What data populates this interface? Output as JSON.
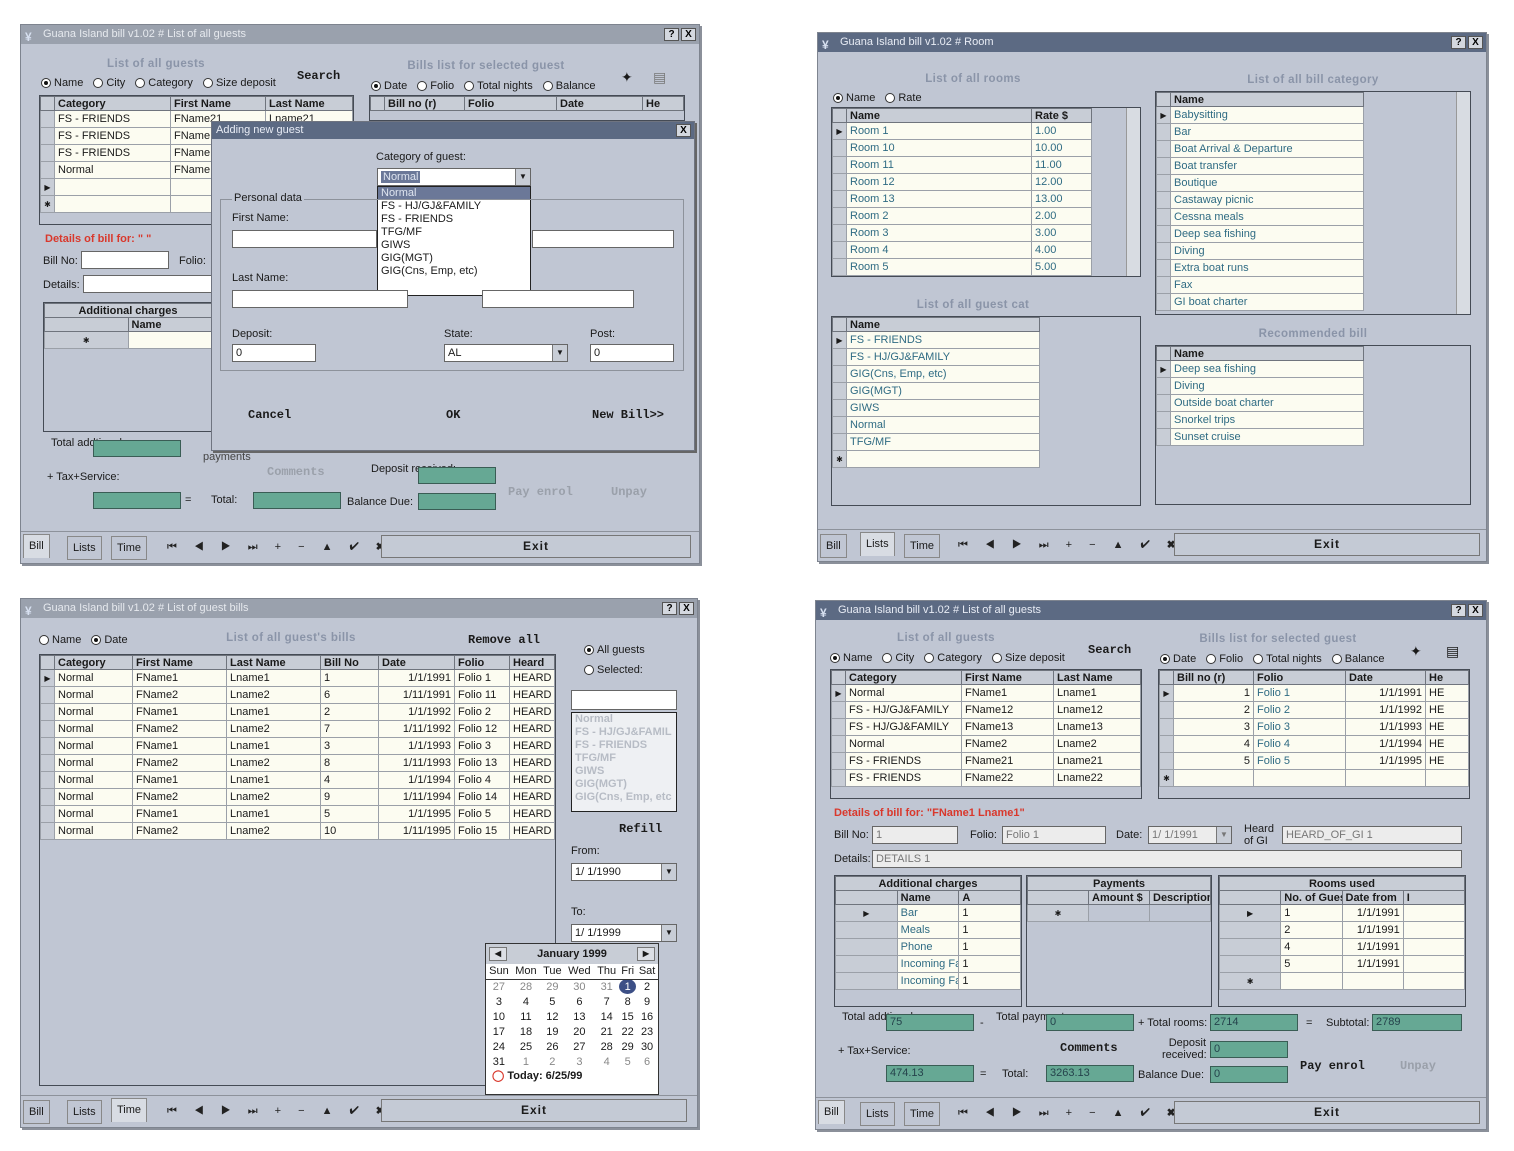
{
  "app_title_bill": "Guana Island bill v1.02 # List of all guests",
  "app_title_room": "Guana Island bill v1.02 # Room",
  "app_title_guest_bills": "Guana Island bill v1.02 # List of guest bills",
  "window_buttons": {
    "help": "?",
    "close": "X"
  },
  "tabs": {
    "bill": "Bill",
    "lists": "Lists",
    "time": "Time"
  },
  "exit_label": "Exit",
  "nav_glyphs": "⏮ ◀ ▶ ⏭ + − ▲ ✔ ✖ ↻",
  "guests_section": {
    "title": "List of all guests",
    "search_label": "Search",
    "radio_name": "Name",
    "radio_city": "City",
    "radio_category": "Category",
    "radio_size_deposit": "Size deposit",
    "columns": [
      "Category",
      "First Name",
      "Last Name"
    ]
  },
  "bills_section": {
    "title": "Bills list for selected guest",
    "radio_date": "Date",
    "radio_folio": "Folio",
    "radio_total_nights": "Total nights",
    "radio_balance": "Balance",
    "columns": [
      "Bill no (r)",
      "Folio",
      "Date",
      "He"
    ]
  },
  "win1": {
    "guest_rows": [
      {
        "cat": "FS - FRIENDS",
        "first": "FName21",
        "last": "Lname21"
      },
      {
        "cat": "FS - FRIENDS",
        "first": "FName",
        "last": ""
      },
      {
        "cat": "FS - FRIENDS",
        "first": "FName",
        "last": ""
      },
      {
        "cat": "Normal",
        "first": "FName",
        "last": ""
      }
    ],
    "details_title": "Details of bill for: \" \"",
    "bill_no": "Bill No:",
    "folio": "Folio:",
    "details": "Details:",
    "additional_charges": "Additional charges",
    "name_col": "Name",
    "total_additional": "Total addtional:",
    "payments": "payments",
    "tax_service": "Tax+Service:",
    "comments": "Comments",
    "deposit_received": "Deposit received:",
    "total": "Total:",
    "balance_due": "Balance Due:",
    "pay_enrol": "Pay enrol",
    "unpay": "Unpay",
    "dialog": {
      "title": "Adding new guest",
      "category_label": "Category of guest:",
      "category_value": "Normal",
      "options": [
        "Normal",
        "FS - HJ/GJ&FAMILY",
        "FS - FRIENDS",
        "TFG/MF",
        "GIWS",
        "GIG(MGT)",
        "GIG(Cns, Emp, etc)"
      ],
      "personal_data": "Personal data",
      "first_name": "First Name:",
      "last_name": "Last Name:",
      "deposit": "Deposit:",
      "deposit_value": "0",
      "state": "State:",
      "state_value": "AL",
      "post": "Post:",
      "post_value": "0",
      "cancel": "Cancel",
      "ok": "OK",
      "new_bill": "New Bill>>"
    }
  },
  "win2": {
    "rooms_title": "List of all rooms",
    "radio_name": "Name",
    "radio_rate": "Rate",
    "rooms_columns": [
      "Name",
      "Rate $"
    ],
    "rooms": [
      {
        "name": "Room 1",
        "rate": "1.00"
      },
      {
        "name": "Room 10",
        "rate": "10.00"
      },
      {
        "name": "Room 11",
        "rate": "11.00"
      },
      {
        "name": "Room 12",
        "rate": "12.00"
      },
      {
        "name": "Room 13",
        "rate": "13.00"
      },
      {
        "name": "Room 2",
        "rate": "2.00"
      },
      {
        "name": "Room 3",
        "rate": "3.00"
      },
      {
        "name": "Room 4",
        "rate": "4.00"
      },
      {
        "name": "Room 5",
        "rate": "5.00"
      }
    ],
    "bill_cat_title": "List of all bill category",
    "bill_cat_column": "Name",
    "bill_categories": [
      "Babysitting",
      "Bar",
      "Boat Arrival & Departure",
      "Boat transfer",
      "Boutique",
      "Castaway picnic",
      "Cessna meals",
      "Deep sea fishing",
      "Diving",
      "Extra boat runs",
      "Fax",
      "GI boat charter"
    ],
    "guest_cat_title": "List of all guest cat",
    "guest_cat_column": "Name",
    "guest_categories": [
      "FS - FRIENDS",
      "FS - HJ/GJ&FAMILY",
      "GIG(Cns, Emp, etc)",
      "GIG(MGT)",
      "GIWS",
      "Normal",
      "TFG/MF"
    ],
    "recommended_title": "Recommended bill",
    "recommended_column": "Name",
    "recommended": [
      "Deep sea fishing",
      "Diving",
      "Outside boat charter",
      "Snorkel trips",
      "Sunset cruise"
    ]
  },
  "win3": {
    "radio_name": "Name",
    "radio_date": "Date",
    "title": "List of all guest's bills",
    "remove_all": "Remove all",
    "columns": [
      "Category",
      "First Name",
      "Last Name",
      "Bill No",
      "Date",
      "Folio",
      "Heard"
    ],
    "rows": [
      {
        "cat": "Normal",
        "first": "FName1",
        "last": "Lname1",
        "no": "1",
        "date": "1/1/1991",
        "folio": "Folio 1",
        "heard": "HEARD"
      },
      {
        "cat": "Normal",
        "first": "FName2",
        "last": "Lname2",
        "no": "6",
        "date": "1/11/1991",
        "folio": "Folio 11",
        "heard": "HEARD"
      },
      {
        "cat": "Normal",
        "first": "FName1",
        "last": "Lname1",
        "no": "2",
        "date": "1/1/1992",
        "folio": "Folio 2",
        "heard": "HEARD"
      },
      {
        "cat": "Normal",
        "first": "FName2",
        "last": "Lname2",
        "no": "7",
        "date": "1/11/1992",
        "folio": "Folio 12",
        "heard": "HEARD"
      },
      {
        "cat": "Normal",
        "first": "FName1",
        "last": "Lname1",
        "no": "3",
        "date": "1/1/1993",
        "folio": "Folio 3",
        "heard": "HEARD"
      },
      {
        "cat": "Normal",
        "first": "FName2",
        "last": "Lname2",
        "no": "8",
        "date": "1/11/1993",
        "folio": "Folio 13",
        "heard": "HEARD"
      },
      {
        "cat": "Normal",
        "first": "FName1",
        "last": "Lname1",
        "no": "4",
        "date": "1/1/1994",
        "folio": "Folio 4",
        "heard": "HEARD"
      },
      {
        "cat": "Normal",
        "first": "FName2",
        "last": "Lname2",
        "no": "9",
        "date": "1/11/1994",
        "folio": "Folio 14",
        "heard": "HEARD"
      },
      {
        "cat": "Normal",
        "first": "FName1",
        "last": "Lname1",
        "no": "5",
        "date": "1/1/1995",
        "folio": "Folio 5",
        "heard": "HEARD"
      },
      {
        "cat": "Normal",
        "first": "FName2",
        "last": "Lname2",
        "no": "10",
        "date": "1/11/1995",
        "folio": "Folio 15",
        "heard": "HEARD"
      }
    ],
    "all_guests": "All guests",
    "selected": "Selected:",
    "selected_list": [
      "Normal",
      "FS - HJ/GJ&FAMIL",
      "FS - FRIENDS",
      "TFG/MF",
      "GIWS",
      "GIG(MGT)",
      "GIG(Cns, Emp, etc"
    ],
    "refill": "Refill",
    "from_label": "From:",
    "from_value": "1/ 1/1990",
    "to_label": "To:",
    "to_value": "1/ 1/1999",
    "calendar": {
      "month": "January 1999",
      "days": [
        "Sun",
        "Mon",
        "Tue",
        "Wed",
        "Thu",
        "Fri",
        "Sat"
      ],
      "weeks": [
        [
          "27",
          "28",
          "29",
          "30",
          "31",
          "1",
          "2"
        ],
        [
          "3",
          "4",
          "5",
          "6",
          "7",
          "8",
          "9"
        ],
        [
          "10",
          "11",
          "12",
          "13",
          "14",
          "15",
          "16"
        ],
        [
          "17",
          "18",
          "19",
          "20",
          "21",
          "22",
          "23"
        ],
        [
          "24",
          "25",
          "26",
          "27",
          "28",
          "29",
          "30"
        ],
        [
          "31",
          "1",
          "2",
          "3",
          "4",
          "5",
          "6"
        ]
      ],
      "today": "Today: 6/25/99"
    }
  },
  "win4": {
    "guest_rows": [
      {
        "cat": "Normal",
        "first": "FName1",
        "last": "Lname1"
      },
      {
        "cat": "FS - HJ/GJ&FAMILY",
        "first": "FName12",
        "last": "Lname12"
      },
      {
        "cat": "FS - HJ/GJ&FAMILY",
        "first": "FName13",
        "last": "Lname13"
      },
      {
        "cat": "Normal",
        "first": "FName2",
        "last": "Lname2"
      },
      {
        "cat": "FS - FRIENDS",
        "first": "FName21",
        "last": "Lname21"
      },
      {
        "cat": "FS - FRIENDS",
        "first": "FName22",
        "last": "Lname22"
      }
    ],
    "bill_rows": [
      {
        "no": "1",
        "folio": "Folio 1",
        "date": "1/1/1991",
        "he": "HE"
      },
      {
        "no": "2",
        "folio": "Folio 2",
        "date": "1/1/1992",
        "he": "HE"
      },
      {
        "no": "3",
        "folio": "Folio 3",
        "date": "1/1/1993",
        "he": "HE"
      },
      {
        "no": "4",
        "folio": "Folio 4",
        "date": "1/1/1994",
        "he": "HE"
      },
      {
        "no": "5",
        "folio": "Folio 5",
        "date": "1/1/1995",
        "he": "HE"
      }
    ],
    "details_title": "Details of bill for: \"FName1 Lname1\"",
    "bill_no_label": "Bill No:",
    "bill_no_value": "1",
    "folio_label": "Folio:",
    "folio_value": "Folio 1",
    "date_label": "Date:",
    "date_value": "1/ 1/1991",
    "heard_label": "Heard of GI",
    "heard_value": "HEARD_OF_GI 1",
    "details_label": "Details:",
    "details_value": "DETAILS 1",
    "additional_title": "Additional charges",
    "additional_columns": [
      "Name",
      "A"
    ],
    "additional_rows": [
      {
        "name": "Bar",
        "a": "1"
      },
      {
        "name": "Meals",
        "a": "1"
      },
      {
        "name": "Phone",
        "a": "1"
      },
      {
        "name": "Incoming Fax",
        "a": "1"
      },
      {
        "name": "Incoming Fax",
        "a": "1"
      }
    ],
    "payments_title": "Payments",
    "payments_columns": [
      "Amount $",
      "Description"
    ],
    "rooms_title": "Rooms used",
    "rooms_columns": [
      "No. of Guests",
      "Date from",
      "I"
    ],
    "rooms_rows": [
      {
        "n": "1",
        "d": "1/1/1991"
      },
      {
        "n": "2",
        "d": "1/1/1991"
      },
      {
        "n": "4",
        "d": "1/1/1991"
      },
      {
        "n": "5",
        "d": "1/1/1991"
      }
    ],
    "total_additional_label": "Total addtional:",
    "total_additional_value": "75",
    "total_payments_label": "Total payments:",
    "total_payments_value": "0",
    "total_rooms_label": "Total rooms:",
    "total_rooms_value": "2714",
    "subtotal_label": "Subtotal:",
    "subtotal_value": "2789",
    "tax_label": "Tax+Service:",
    "tax_value": "474.13",
    "comments": "Comments",
    "deposit_label": "Deposit received:",
    "deposit_value": "0",
    "total_label": "Total:",
    "total_value": "3263.13",
    "balance_label": "Balance Due:",
    "balance_value": "0",
    "pay_enrol": "Pay enrol",
    "unpay": "Unpay"
  },
  "colors": {
    "window": "#c0c6d3",
    "titlebar": "#5c6a83",
    "green_field": "#66a894",
    "red_heading": "#d9382c"
  }
}
